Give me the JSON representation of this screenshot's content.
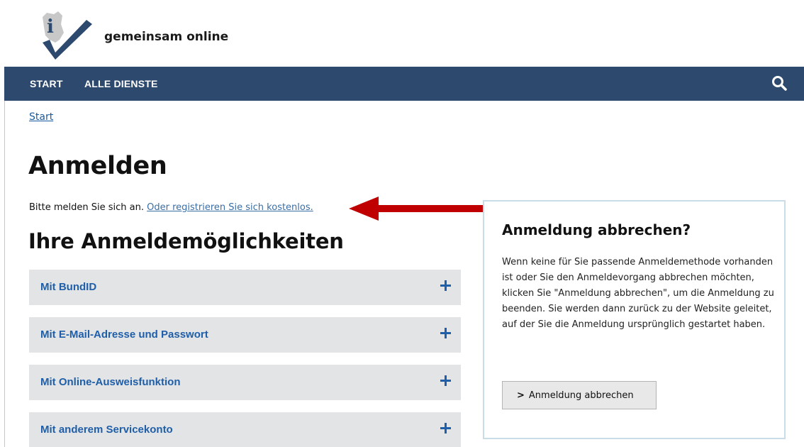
{
  "header": {
    "brand": "gemeinsam online"
  },
  "nav": {
    "items": [
      "START",
      "ALLE DIENSTE"
    ]
  },
  "breadcrumb": "Start",
  "main": {
    "title": "Anmelden",
    "intro_text": "Bitte melden Sie sich an.",
    "register_link": "Oder registrieren Sie sich kostenlos.",
    "options_heading": "Ihre Anmeldemöglichkeiten",
    "options": [
      "Mit BundID",
      "Mit E-Mail-Adresse und Passwort",
      "Mit Online-Ausweisfunktion",
      "Mit anderem Servicekonto"
    ]
  },
  "sidebar": {
    "heading": "Anmeldung abbrechen?",
    "text": "Wenn keine für Sie passende Anmeldemethode vorhanden ist oder Sie den Anmeldevorgang abbrechen möchten, klicken Sie \"Anmeldung abbrechen\", um die Anmeldung zu beenden. Sie werden dann zurück zu der Website geleitet, auf der Sie die Anmeldung ursprünglich gestartet haben.",
    "button_label": "Anmeldung abbrechen",
    "button_icon": "chevron-right-icon"
  },
  "colors": {
    "nav_bg": "#2d4a6e",
    "link": "#1f5ea8",
    "accordion_bg": "#e3e4e5",
    "arrow": "#c00000",
    "box_border": "#c9dde9"
  }
}
